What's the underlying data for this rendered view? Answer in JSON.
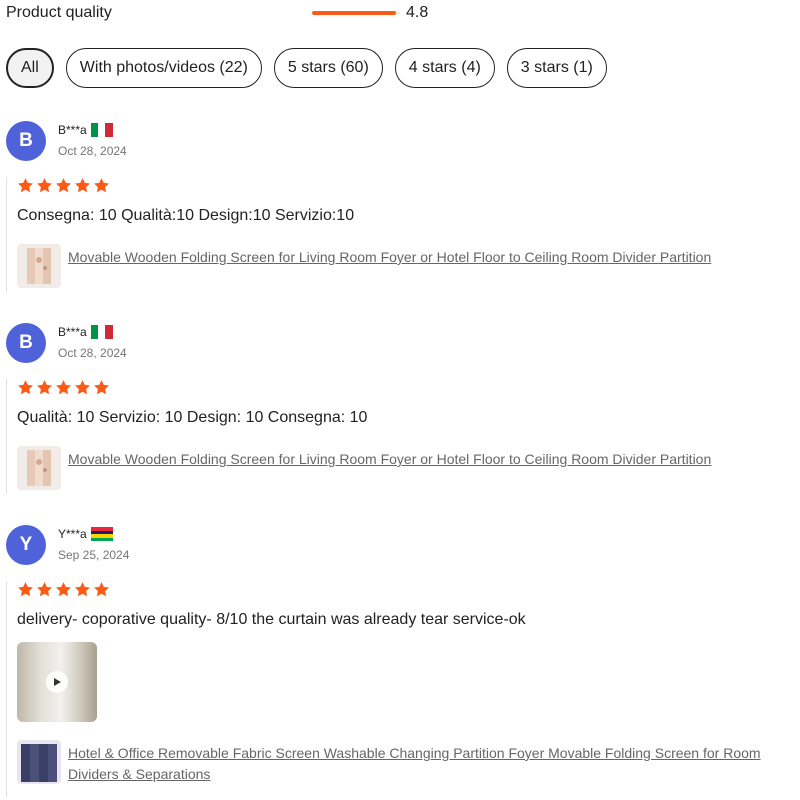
{
  "rating_summary": {
    "label": "Product quality",
    "score": "4.8",
    "fill_fraction": 0.96
  },
  "filters": [
    {
      "label": "All",
      "active": true
    },
    {
      "label": "With photos/videos (22)",
      "active": false
    },
    {
      "label": "5 stars (60)",
      "active": false
    },
    {
      "label": "4 stars (4)",
      "active": false
    },
    {
      "label": "3 stars (1)",
      "active": false
    }
  ],
  "reviews": [
    {
      "initial": "B",
      "name": "B***a",
      "flag": "italy-flag",
      "date": "Oct 28, 2024",
      "stars": 5,
      "text": "Consegna: 10 Qualità:10  Design:10  Servizio:10",
      "product_link": "Movable Wooden Folding Screen for Living Room Foyer or Hotel Floor to Ceiling Room Divider Partition"
    },
    {
      "initial": "B",
      "name": "B***a",
      "flag": "italy-flag",
      "date": "Oct 28, 2024",
      "stars": 5,
      "text": "Qualità: 10 Servizio: 10 Design: 10 Consegna: 10",
      "product_link": "Movable Wooden Folding Screen for Living Room Foyer or Hotel Floor to Ceiling Room Divider Partition"
    },
    {
      "initial": "Y",
      "name": "Y***a",
      "flag": "mauritius-flag",
      "date": "Sep 25, 2024",
      "stars": 5,
      "text": "delivery- coporative quality- 8/10 the curtain was already tear service-ok",
      "has_video": true,
      "product_link": "Hotel & Office Removable Fabric Screen Washable Changing Partition Foyer Movable Folding Screen for Room Dividers & Separations"
    }
  ],
  "colors": {
    "accent": "#fd5a16",
    "avatar": "#4f62d9",
    "link": "#666666"
  }
}
